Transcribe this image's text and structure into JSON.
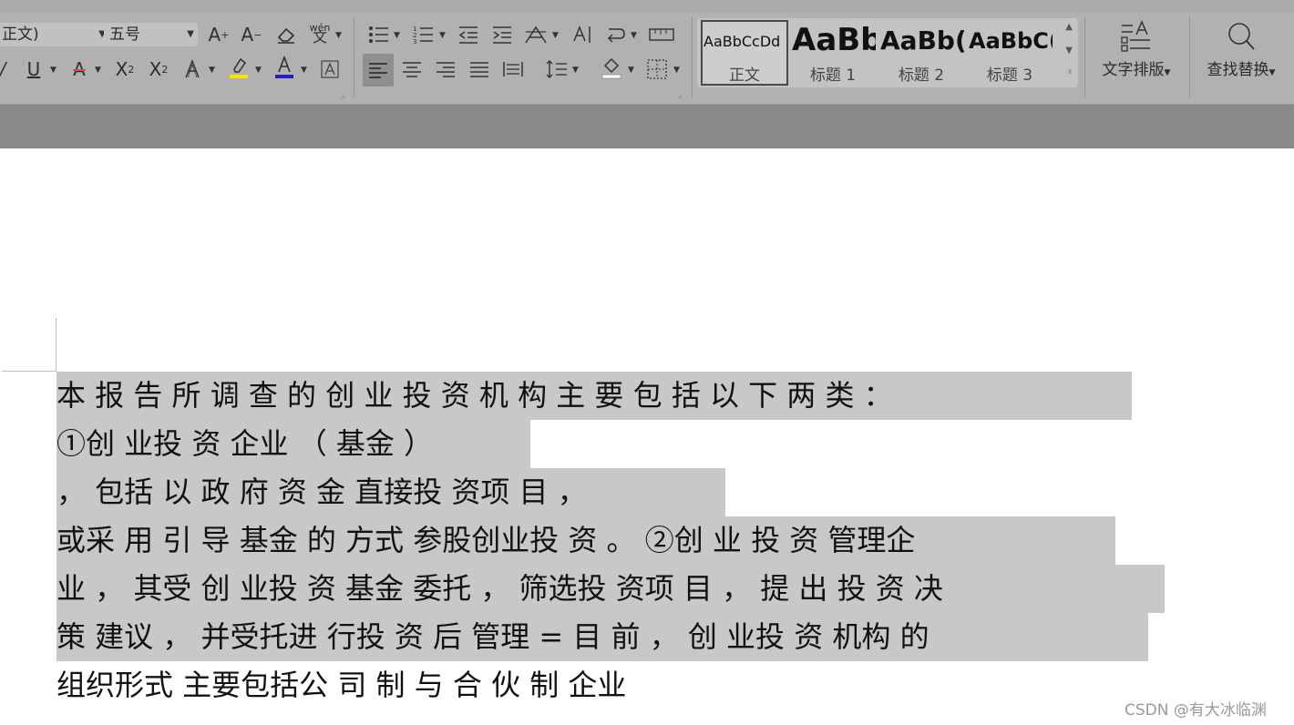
{
  "font": {
    "family_value": "正文)",
    "size_value": "五号"
  },
  "styles": {
    "items": [
      {
        "preview": "AaBbCcDd",
        "name": "正文"
      },
      {
        "preview": "AaBb",
        "name": "标题 1"
      },
      {
        "preview": "AaBb(",
        "name": "标题 2"
      },
      {
        "preview": "AaBbC(",
        "name": "标题 3"
      }
    ]
  },
  "buttons": {
    "text_layout": "文字排版",
    "find_replace": "查找替换",
    "pinyin_guide": "wén"
  },
  "document": {
    "lines": [
      "本 报 告 所 调 查 的 创 业 投 资 机 构 主 要 包 括 以 下 两 类 ：",
      "①创 业投 资 企业 （ 基金 ）",
      "， 包括 以 政 府 资 金 直接投 资项 目 ，",
      "或采 用 引 导 基金 的 方式 参股创业投 资 。 ②创 业 投 资 管理企",
      "业 ， 其受 创 业投 资 基金 委托 ， 筛选投 资项 目 ， 提 出 投 资 决",
      "策 建议 ， 并受托进 行投 资 后 管理 = 目 前 ， 创 业投 资 机构 的",
      "组织形式 主要包括公 司 制 与 合 伙 制 企业"
    ]
  },
  "watermark": "CSDN @有大冰临渊",
  "colors": {
    "highlight": "#f5e400",
    "font_color": "#1f1fc8",
    "clear_red": "#d84a4a"
  }
}
